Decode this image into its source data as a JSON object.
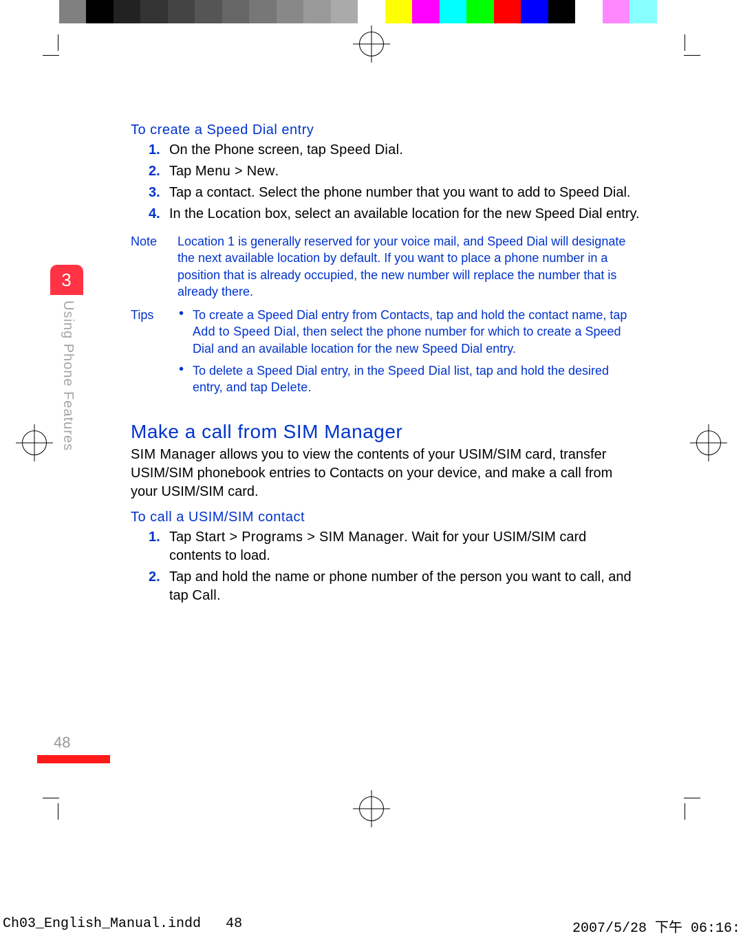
{
  "printer_marks": {
    "present": true
  },
  "side_tab": {
    "chapter_number": "3",
    "chapter_title": "Using Phone Features"
  },
  "page_number": "48",
  "sec1_heading": "To create a Speed Dial entry",
  "sec1_steps": {
    "s1a": "On the Phone screen, tap ",
    "s1b": "Speed Dial",
    "s1c": ".",
    "s2a": "Tap ",
    "s2b": "Menu > New",
    "s2c": ".",
    "s3": "Tap a contact. Select the phone number that you want to add to Speed Dial.",
    "s4a": "In the ",
    "s4b": "Location",
    "s4c": " box, select an available location for the new Speed Dial entry."
  },
  "note_label": "Note",
  "note_body": "Location 1 is generally reserved for your voice mail, and Speed Dial will designate the next available location by default. If you want to place a phone number in a position that is already occupied, the new number will replace the number that is already there.",
  "tips_label": "Tips",
  "tip1a": "To create a Speed Dial entry from Contacts, tap and hold the contact name, tap ",
  "tip1b": "Add to Speed Dial",
  "tip1c": ", then select the phone number for which to create a Speed Dial and an available location for the new Speed Dial entry.",
  "tip2a": "To delete a Speed Dial entry, in the ",
  "tip2b": "Speed Dial",
  "tip2c": " list, tap and hold the desired entry, and tap ",
  "tip2d": "Delete",
  "tip2e": ".",
  "h2": "Make a call from SIM Manager",
  "intro_a": "SIM Manager",
  "intro_b": " allows you to view the contents of your USIM/SIM card, transfer USIM/SIM phonebook entries to Contacts on your device, and make a call from your USIM/SIM card.",
  "sec2_heading": "To call a USIM/SIM contact",
  "sec2_steps": {
    "s1a": "Tap ",
    "s1b": "Start > Programs > SIM Manager",
    "s1c": ". Wait for your USIM/SIM card contents to load.",
    "s2a": "Tap and hold the name or phone number of the person you want to call, and tap ",
    "s2b": "Call",
    "s2c": "."
  },
  "imposition": {
    "file": "Ch03_English_Manual.indd",
    "page": "48",
    "timestamp": "2007/5/28   下午 06:16:"
  }
}
